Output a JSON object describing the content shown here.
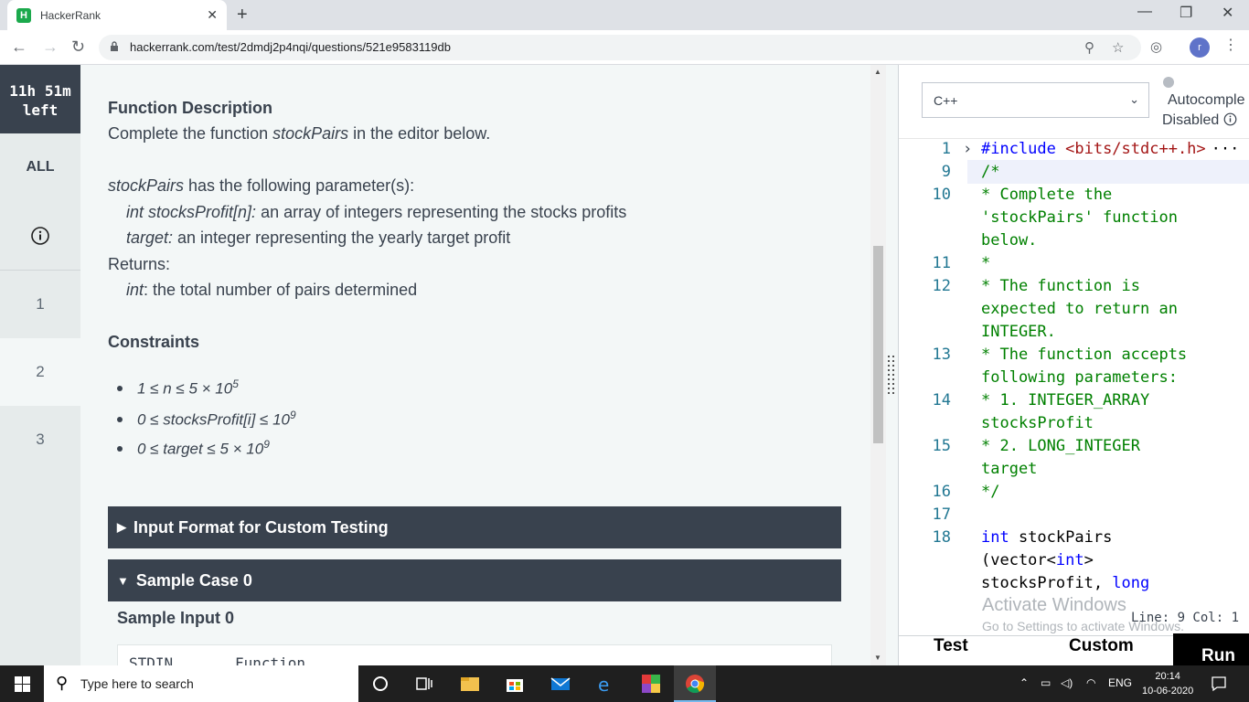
{
  "browser": {
    "tab_title": "HackerRank",
    "favicon_letter": "H",
    "url": "hackerrank.com/test/2dmdj2p4nqi/questions/521e9583119db",
    "profile_initial": "r"
  },
  "leftnav": {
    "timer_line1": "11h 51m",
    "timer_line2": "left",
    "all_label": "ALL",
    "questions": [
      "1",
      "2",
      "3"
    ],
    "active_question": "2"
  },
  "description": {
    "fd_heading": "Function Description",
    "fd_text_pre": "Complete the function ",
    "fd_func": "stockPairs",
    "fd_text_post": " in the editor below.",
    "params_func": "stockPairs",
    "params_text": " has the following parameter(s):",
    "param1_name": "int stocksProfit[n]:",
    "param1_desc": " an array of integers representing the stocks profits",
    "param2_name": "target:",
    "param2_desc": " an integer representing the yearly target profit",
    "returns_label": "Returns:",
    "returns_type": "int",
    "returns_desc": ": the total number of pairs determined",
    "constraints_heading": "Constraints",
    "c1": "1 ≤ n ≤ 5 × 10",
    "c1_exp": "5",
    "c2": "0 ≤ stocksProfit[i] ≤ 10",
    "c2_exp": "9",
    "c3": "0 ≤  target ≤ 5 × 10",
    "c3_exp": "9",
    "accordion1": "Input Format for Custom Testing",
    "accordion2": "Sample Case 0",
    "sample_input_heading": "Sample Input 0",
    "stdin_col": "STDIN",
    "function_col": "Function"
  },
  "editor": {
    "language": "C++",
    "autocomplete_line1": "Autocomple",
    "autocomplete_line2": "Disabled",
    "status": "Line: 9 Col: 1",
    "watermark1": "Activate Windows",
    "watermark2": "Go to Settings to activate Windows.",
    "btn_test": "Test",
    "btn_custom": "Custom",
    "btn_run": "Run",
    "line_numbers": [
      "1",
      "9",
      "10",
      "11",
      "12",
      "13",
      "14",
      "15",
      "16",
      "17",
      "18"
    ],
    "code": {
      "l1_kw": "#include",
      "l1_str": " <bits/stdc++.h>",
      "l1_fold": "···",
      "l9": "/*",
      "l10a": " * Complete the",
      "l10b": "'stockPairs' function",
      "l10c": "below.",
      "l11": " *",
      "l12a": " * The function is",
      "l12b": "expected to return an",
      "l12c": "INTEGER.",
      "l13a": " * The function accepts",
      "l13b": "following parameters:",
      "l14a": " *  1. INTEGER_ARRAY",
      "l14b": "stocksProfit",
      "l15a": " *  2. LONG_INTEGER",
      "l15b": "target",
      "l16": " */",
      "l18a_kw": "int",
      "l18a_tx": " stockPairs",
      "l18b_tx1": "(vector<",
      "l18b_kw": "int",
      "l18b_tx2": ">",
      "l18c_tx": "stocksProfit, ",
      "l18c_kw": "long"
    }
  },
  "taskbar": {
    "search_placeholder": "Type here to search",
    "lang": "ENG",
    "time": "20:14",
    "date": "10-06-2020"
  },
  "colors": {
    "dark_header": "#39424e",
    "content_bg": "#f3f7f7",
    "nav_bg": "#e6ebeb"
  }
}
